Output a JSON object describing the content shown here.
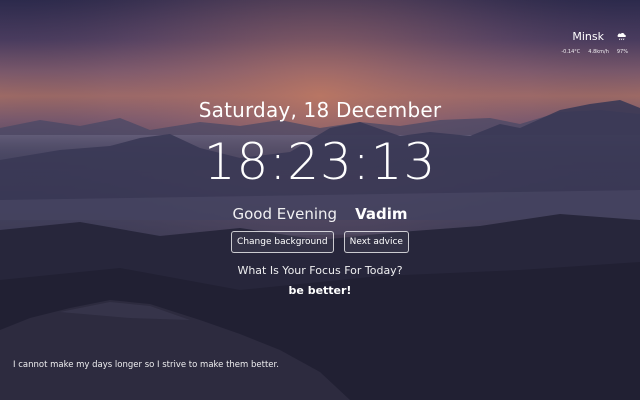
{
  "colors": {
    "text": "#ffffff"
  },
  "weather": {
    "city": "Minsk",
    "icon": "cloud-rain-icon",
    "temperature": "-0.14°C",
    "wind": "4.8km/h",
    "humidity": "97%"
  },
  "date": "Saturday, 18 December",
  "time": "18:23:13",
  "greeting": {
    "text": "Good Evening",
    "name": "Vadim"
  },
  "buttons": {
    "change_background": "Change background",
    "next_advice": "Next advice"
  },
  "focus": {
    "question": "What Is Your Focus For Today?",
    "answer": "be better!"
  },
  "quote": "I cannot make my days longer so I strive to make them better."
}
